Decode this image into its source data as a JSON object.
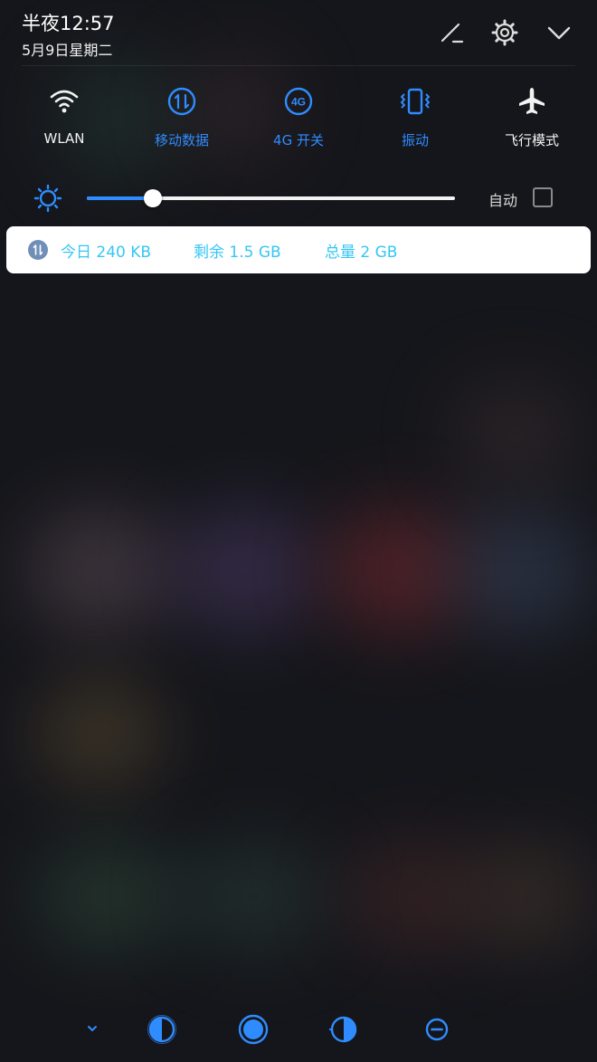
{
  "status": {
    "time": "半夜12:57",
    "date": "5月9日星期二"
  },
  "header_icons": [
    "edit-icon",
    "settings-icon",
    "chevron-down-icon"
  ],
  "toggles": [
    {
      "label": "WLAN",
      "icon": "wifi-icon",
      "active": false
    },
    {
      "label": "移动数据",
      "icon": "mobile-data-icon",
      "active": true
    },
    {
      "label": "4G 开关",
      "icon": "4g-icon",
      "active": true
    },
    {
      "label": "振动",
      "icon": "vibrate-icon",
      "active": true
    },
    {
      "label": "飞行模式",
      "icon": "airplane-icon",
      "active": false
    }
  ],
  "brightness": {
    "level": 0.18,
    "auto_label": "自动",
    "auto_checked": false
  },
  "data_usage": {
    "today": "今日 240 KB",
    "remaining": "剩余 1.5 GB",
    "total": "总量 2 GB"
  },
  "bottom_icons": [
    "collapse-icon",
    "contrast-left-icon",
    "circle-icon",
    "contrast-right-icon",
    "minus-icon"
  ],
  "colors": {
    "accent": "#2f8cff",
    "data_text": "#35c6f4",
    "card_bg": "#ffffff"
  }
}
